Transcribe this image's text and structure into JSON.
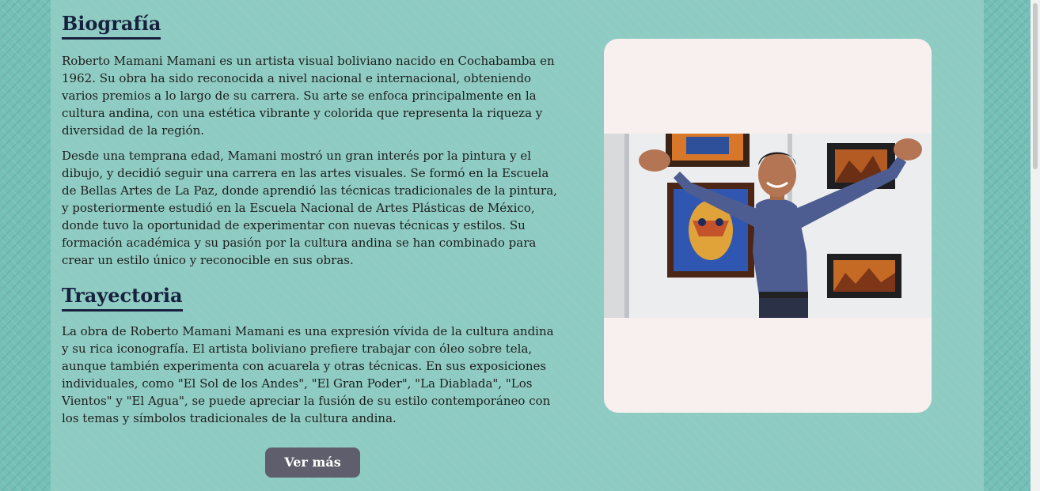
{
  "biografia": {
    "title": "Biografía",
    "paragraphs": [
      "Roberto Mamani Mamani es un artista visual boliviano nacido en Cochabamba en 1962. Su obra ha sido reconocida a nivel nacional e internacional, obteniendo varios premios a lo largo de su carrera. Su arte se enfoca principalmente en la cultura andina, con una estética vibrante y colorida que representa la riqueza y diversidad de la región.",
      "Desde una temprana edad, Mamani mostró un gran interés por la pintura y el dibujo, y decidió seguir una carrera en las artes visuales. Se formó en la Escuela de Bellas Artes de La Paz, donde aprendió las técnicas tradicionales de la pintura, y posteriormente estudió en la Escuela Nacional de Artes Plásticas de México, donde tuvo la oportunidad de experimentar con nuevas técnicas y estilos. Su formación académica y su pasión por la cultura andina se han combinado para crear un estilo único y reconocible en sus obras."
    ]
  },
  "trayectoria": {
    "title": "Trayectoria",
    "paragraphs": [
      "La obra de Roberto Mamani Mamani es una expresión vívida de la cultura andina y su rica iconografía. El artista boliviano prefiere trabajar con óleo sobre tela, aunque también experimenta con acuarela y otras técnicas. En sus exposiciones individuales, como \"El Sol de los Andes\", \"El Gran Poder\", \"La Diablada\", \"Los Vientos\" y \"El Agua\", se puede apreciar la fusión de su estilo contemporáneo con los temas y símbolos tradicionales de la cultura andina."
    ]
  },
  "button": {
    "label": "Ver más"
  },
  "colors": {
    "page_background": "#74bfb6",
    "panel_background": "#8ecbc2",
    "heading": "#16213e",
    "button_background": "#5e5e6c",
    "card_background": "#f7f0ef"
  }
}
